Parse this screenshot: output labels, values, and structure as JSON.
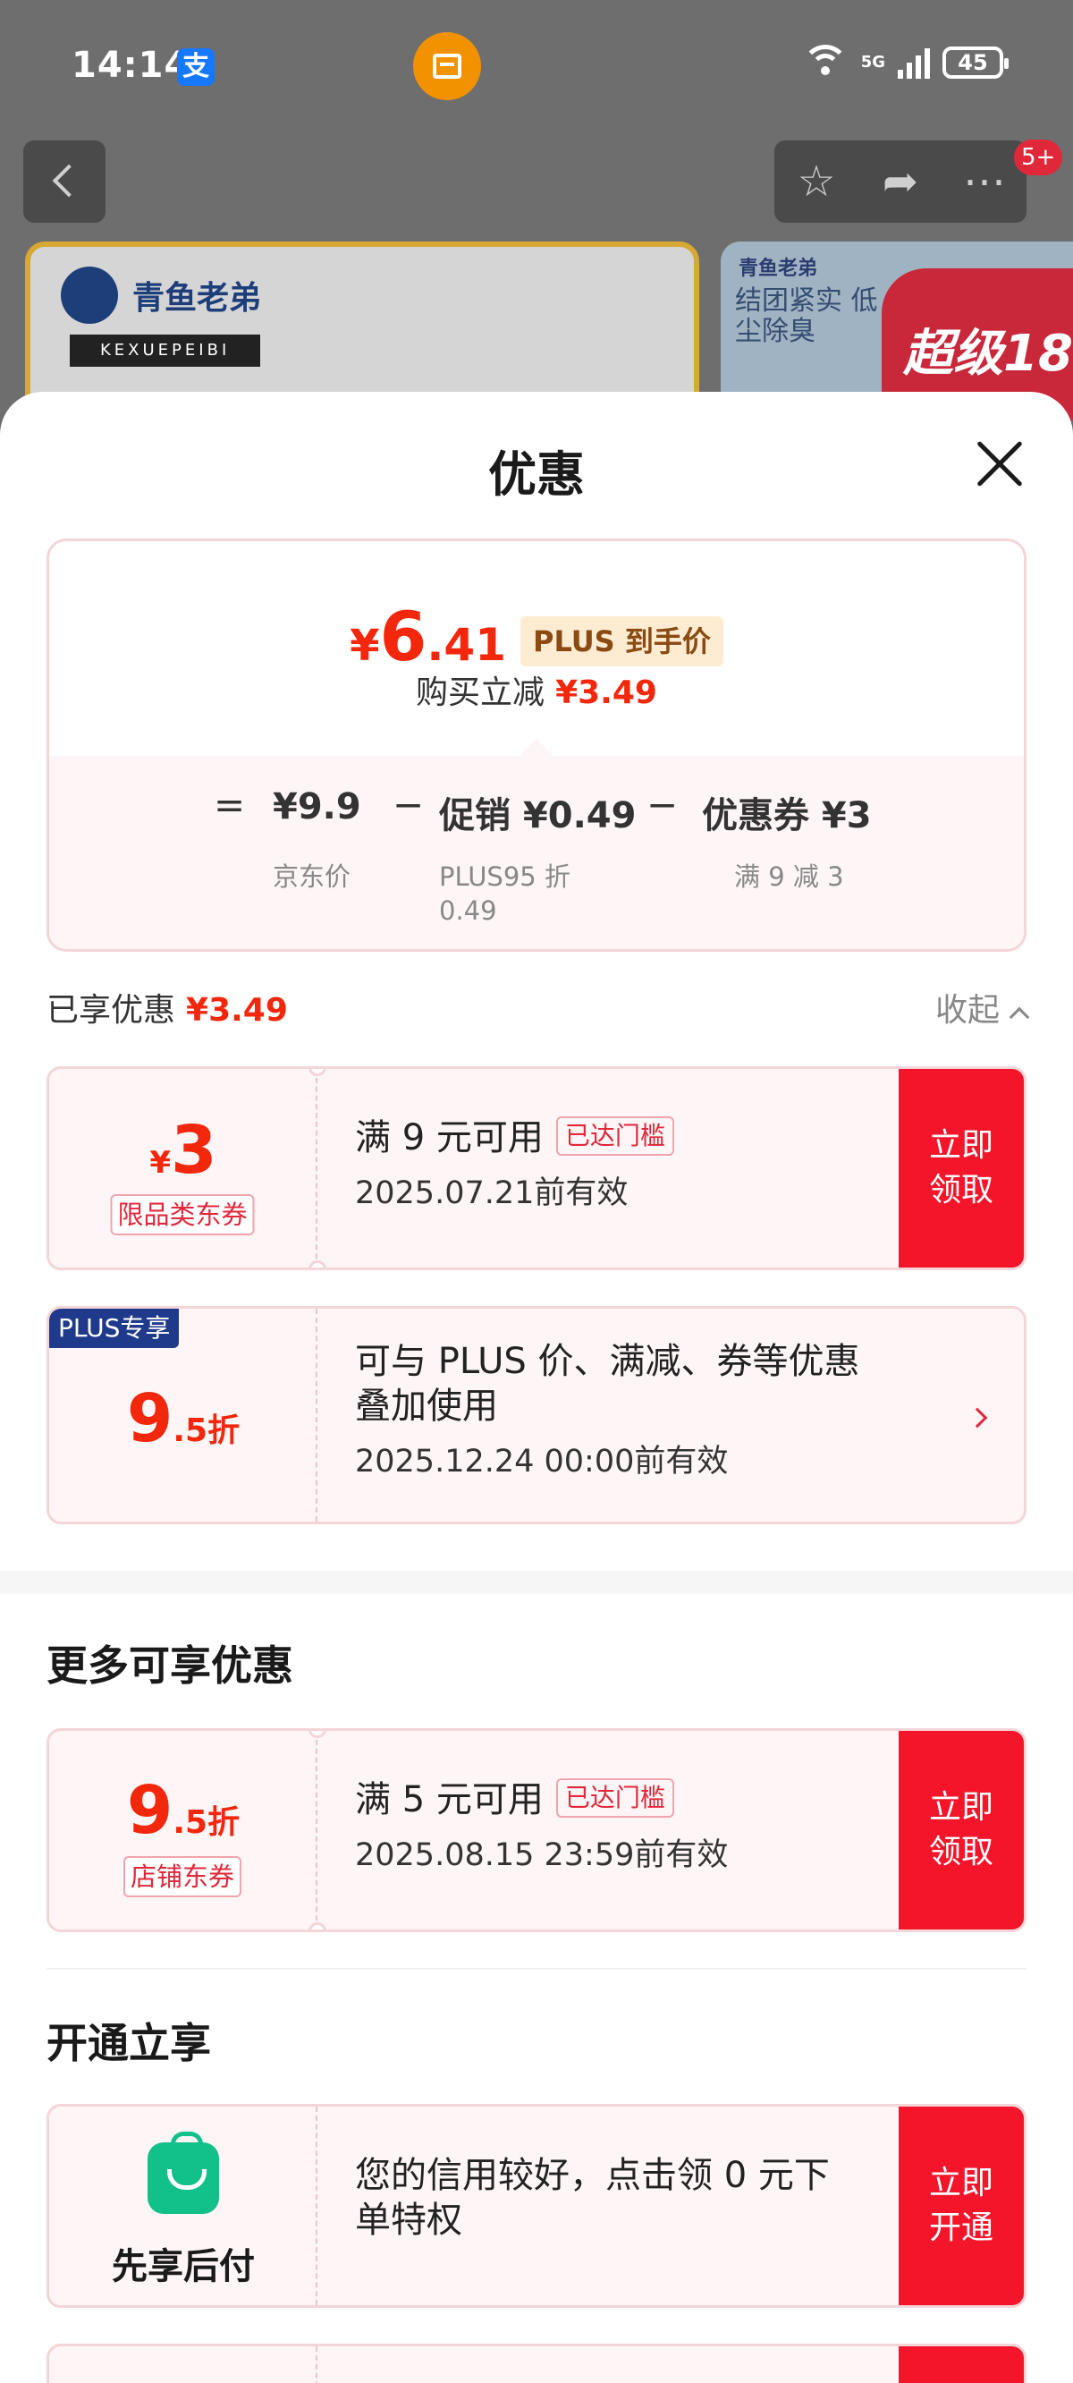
{
  "status_bar": {
    "time": "14:14",
    "alipay_glyph": "支",
    "net_label": "5G",
    "battery": "45"
  },
  "nav": {
    "badge": "5+"
  },
  "backdrop": {
    "brand_name": "青鱼老弟",
    "brand_sub": "KEXUEPEIBI",
    "right_brand": "青鱼老弟",
    "right_text": "结团紧实 低尘除臭",
    "right_promo": "超级18"
  },
  "sheet": {
    "title": "优惠",
    "price": {
      "symbol": "¥",
      "int": "6",
      "dec": ".41",
      "tag": "PLUS 到手价"
    },
    "reduce": {
      "label": "购买立减",
      "amount": "¥3.49"
    },
    "breakdown": {
      "eq": "=",
      "minus": "−",
      "items": [
        {
          "value": "¥9.9",
          "sub": "京东价"
        },
        {
          "value": "促销 ¥0.49",
          "sub": "PLUS95 折",
          "sub2": "0.49"
        },
        {
          "value": "优惠券 ¥3",
          "sub": "满 9 减 3"
        }
      ]
    },
    "enjoyed": {
      "label": "已享优惠",
      "amount": "¥3.49",
      "collapse": "收起"
    },
    "coupon1": {
      "symbol": "¥",
      "amount": "3",
      "tag": "限品类东券",
      "line1": "满 9 元可用",
      "reach": "已达门槛",
      "line2": "2025.07.21前有效",
      "btn": "立即领取"
    },
    "coupon2": {
      "badge": "PLUS专享",
      "amount": "9",
      "unit": ".5折",
      "line1": "可与 PLUS 价、满减、券等优惠",
      "line1b": "叠加使用",
      "line2": "2025.12.24 00:00前有效"
    },
    "more_title": "更多可享优惠",
    "coupon3": {
      "amount": "9",
      "unit": ".5折",
      "tag": "店铺东券",
      "line1": "满 5 元可用",
      "reach": "已达门槛",
      "line2": "2025.08.15 23:59前有效",
      "btn": "立即领取"
    },
    "open_title": "开通立享",
    "paylater": {
      "label": "先享后付",
      "line1": "您的信用较好，点击领 0 元下",
      "line1b": "单特权",
      "btn": "立即开通"
    }
  }
}
